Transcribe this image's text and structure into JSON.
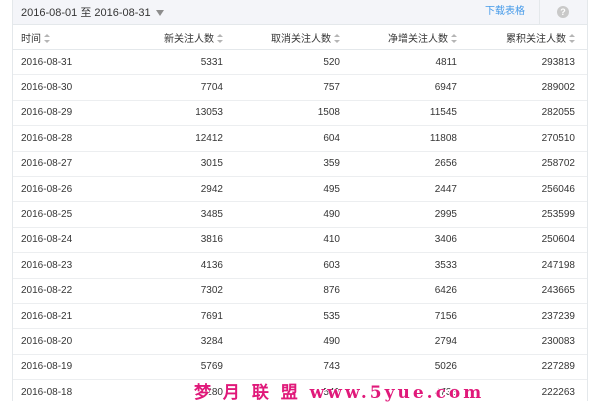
{
  "toolbar": {
    "date_range": "2016-08-01 至 2016-08-31",
    "download_label": "下载表格",
    "help_glyph": "?"
  },
  "table": {
    "columns": [
      "时间",
      "新关注人数",
      "取消关注人数",
      "净增关注人数",
      "累积关注人数"
    ],
    "rows": [
      [
        "2016-08-31",
        "5331",
        "520",
        "4811",
        "293813"
      ],
      [
        "2016-08-30",
        "7704",
        "757",
        "6947",
        "289002"
      ],
      [
        "2016-08-29",
        "13053",
        "1508",
        "11545",
        "282055"
      ],
      [
        "2016-08-28",
        "12412",
        "604",
        "11808",
        "270510"
      ],
      [
        "2016-08-27",
        "3015",
        "359",
        "2656",
        "258702"
      ],
      [
        "2016-08-26",
        "2942",
        "495",
        "2447",
        "256046"
      ],
      [
        "2016-08-25",
        "3485",
        "490",
        "2995",
        "253599"
      ],
      [
        "2016-08-24",
        "3816",
        "410",
        "3406",
        "250604"
      ],
      [
        "2016-08-23",
        "4136",
        "603",
        "3533",
        "247198"
      ],
      [
        "2016-08-22",
        "7302",
        "876",
        "6426",
        "243665"
      ],
      [
        "2016-08-21",
        "7691",
        "535",
        "7156",
        "237239"
      ],
      [
        "2016-08-20",
        "3284",
        "490",
        "2794",
        "230083"
      ],
      [
        "2016-08-19",
        "5769",
        "743",
        "5026",
        "227289"
      ],
      [
        "2016-08-18",
        "5280",
        "542",
        "4738",
        "222263"
      ]
    ]
  },
  "watermark": "梦 月 联 盟  www.5yue.com",
  "colors": {
    "accent_link": "#459ae9",
    "toolbar_bg": "#f4f5f9",
    "watermark": "#e0197a"
  },
  "icons": {
    "date_dropdown": "caret-down-icon",
    "help": "help-icon",
    "sort": "sort-icon"
  }
}
